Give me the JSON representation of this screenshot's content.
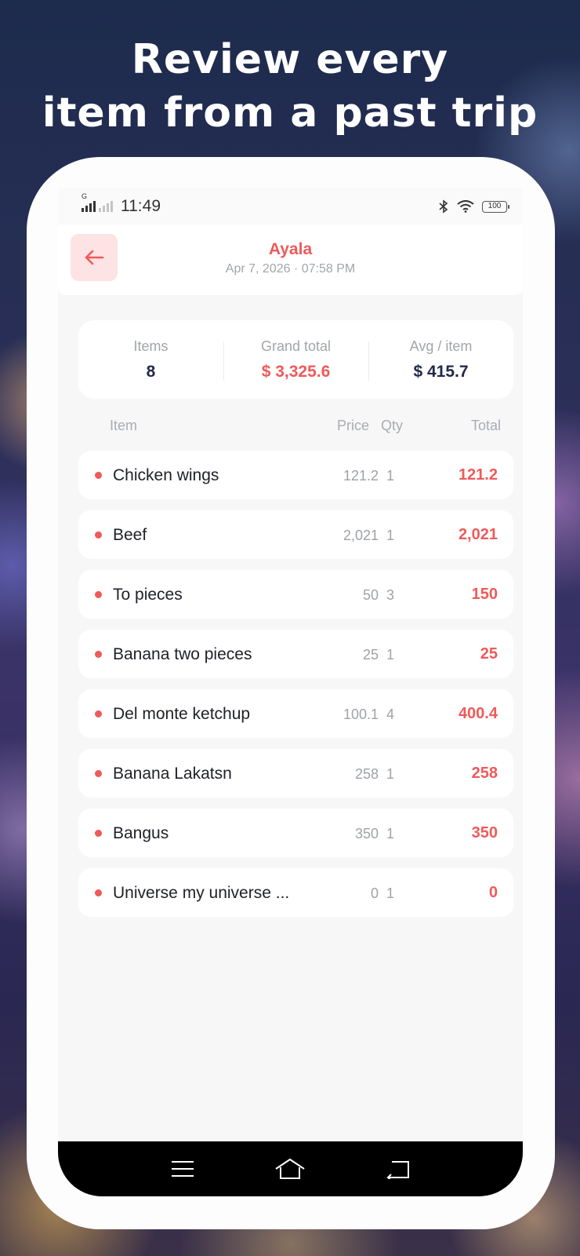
{
  "promo": {
    "headline_line1": "Review every",
    "headline_line2": "item from a past trip"
  },
  "statusbar": {
    "network_label": "G",
    "time": "11:49",
    "battery": "100",
    "icons": [
      "signal-icon",
      "bluetooth-icon",
      "wifi-icon",
      "battery-icon"
    ]
  },
  "header": {
    "back_icon": "arrow-left-icon",
    "store": "Ayala",
    "datetime": "Apr 7, 2026 · 07:58 PM"
  },
  "summary": {
    "items_label": "Items",
    "items_value": "8",
    "grand_total_label": "Grand total",
    "grand_total_value": "$ 3,325.6",
    "avg_label": "Avg / item",
    "avg_value": "$ 415.7"
  },
  "table": {
    "headers": {
      "item": "Item",
      "price": "Price",
      "qty": "Qty",
      "total": "Total"
    },
    "rows": [
      {
        "name": "Chicken wings",
        "price": "121.2",
        "qty": "1",
        "total": "121.2"
      },
      {
        "name": "Beef",
        "price": "2,021",
        "qty": "1",
        "total": "2,021"
      },
      {
        "name": "To pieces",
        "price": "50",
        "qty": "3",
        "total": "150"
      },
      {
        "name": "Banana two pieces",
        "price": "25",
        "qty": "1",
        "total": "25"
      },
      {
        "name": "Del monte ketchup",
        "price": "100.1",
        "qty": "4",
        "total": "400.4"
      },
      {
        "name": "Banana Lakatsn",
        "price": "258",
        "qty": "1",
        "total": "258"
      },
      {
        "name": "Bangus",
        "price": "350",
        "qty": "1",
        "total": "350"
      },
      {
        "name": "Universe my universe ...",
        "price": "0",
        "qty": "1",
        "total": "0"
      }
    ]
  },
  "navbar": {
    "icons": [
      "menu-icon",
      "home-icon",
      "back-icon"
    ]
  },
  "colors": {
    "accent": "#ef5a5a",
    "accent_soft": "#fde3e4",
    "dark_text": "#23294a",
    "muted_text": "#a2a5ab"
  }
}
